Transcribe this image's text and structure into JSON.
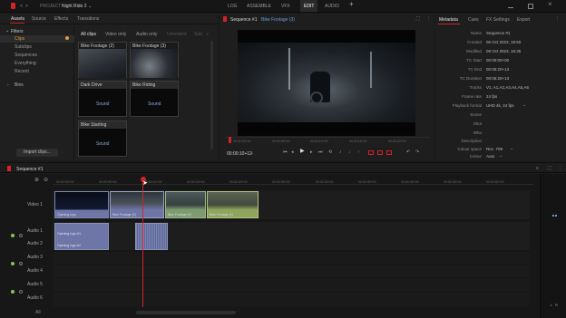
{
  "topbar": {
    "project_label": "PROJECT",
    "project_name": "Night Ride 2",
    "tabs": [
      "LOG",
      "ASSEMBLE",
      "VFX",
      "EDIT",
      "AUDIO"
    ],
    "active_tab": "EDIT",
    "add": "+"
  },
  "browser": {
    "tabs": [
      "Assets",
      "Source",
      "Effects",
      "Transitions"
    ],
    "filters_title": "Filters",
    "filters": [
      "Clips",
      "Subclips",
      "Sequences",
      "Everything",
      "Recent"
    ],
    "bins": "Bins",
    "import_button": "Import clips...",
    "clip_tabs": [
      "All clips",
      "Video only",
      "Audio only",
      "Unrelated",
      "Sub"
    ],
    "clips": [
      {
        "name": "Bike Footage (2)",
        "type": "video"
      },
      {
        "name": "Bike Footage (3)",
        "type": "video"
      },
      {
        "name": "Dark Drive",
        "type": "audio",
        "badge": "Sound"
      },
      {
        "name": "Bike Riding",
        "type": "audio",
        "badge": "Sound"
      },
      {
        "name": "Bike Starting",
        "type": "audio",
        "badge": "Sound"
      }
    ]
  },
  "viewer": {
    "title": "Sequence #1",
    "clip": "Bike Footage (3)",
    "ruler": [
      "00:00:00+00",
      "00:00:05+00",
      "00:00:10+00",
      "00:00:15+00",
      "00:00:20+00"
    ],
    "timecode": "00:00:10+12"
  },
  "metadata": {
    "tabs": [
      "Metadata",
      "Cues",
      "FX Settings",
      "Export"
    ],
    "rows": [
      {
        "k": "Name",
        "v": "Sequence #1"
      },
      {
        "k": "Created",
        "v": "06 Oct 2023, 19:50"
      },
      {
        "k": "Modified",
        "v": "09 Oct 2023, 16:35"
      },
      {
        "k": "TC Start",
        "v": "00:00:00+00"
      },
      {
        "k": "TC End",
        "v": "00:05:20+13"
      },
      {
        "k": "TC Duration",
        "v": "00:05:20+13"
      },
      {
        "k": "Tracks",
        "v": "V1, A1,A2,A3,A4,A5,A6"
      },
      {
        "k": "Frame rate",
        "v": "24 fps"
      },
      {
        "k": "Playback format",
        "v": "UHD 4k, 24 fps"
      },
      {
        "k": "Scene",
        "v": ""
      },
      {
        "k": "Shot",
        "v": ""
      },
      {
        "k": "Who",
        "v": ""
      },
      {
        "k": "Description",
        "v": ""
      },
      {
        "k": "Colour space",
        "v": "Rec. 709"
      },
      {
        "k": "Colour",
        "v": "Auto"
      }
    ]
  },
  "timeline": {
    "title": "Sequence #1",
    "ticks": [
      "00:00:00+00",
      "00:00:05+00",
      "00:00:10+00",
      "00:00:15+00",
      "00:00:20+00",
      "00:00:25+00",
      "00:00:30+00",
      "00:00:35+00",
      "00:00:40+00",
      "00:00:45+00",
      "00:00:50+00"
    ],
    "tracks": {
      "video": "Video 1",
      "audio": [
        "Audio 1",
        "Audio 2",
        "Audio 3",
        "Audio 4",
        "Audio 5",
        "Audio 6"
      ]
    },
    "video_clips": [
      "Opening logo",
      "Bike Footage (2)",
      "Bike Footage (2)",
      "Bike Footage (1)"
    ],
    "audio_clips": [
      "Opening logo.A1",
      "Opening logo.A2"
    ],
    "all_label": "All",
    "meter_labels": [
      "L",
      "R"
    ]
  },
  "colors": {
    "accent": "#d2232a",
    "clip_blue": "#6e76a8",
    "clip_green": "#8fa45c"
  }
}
